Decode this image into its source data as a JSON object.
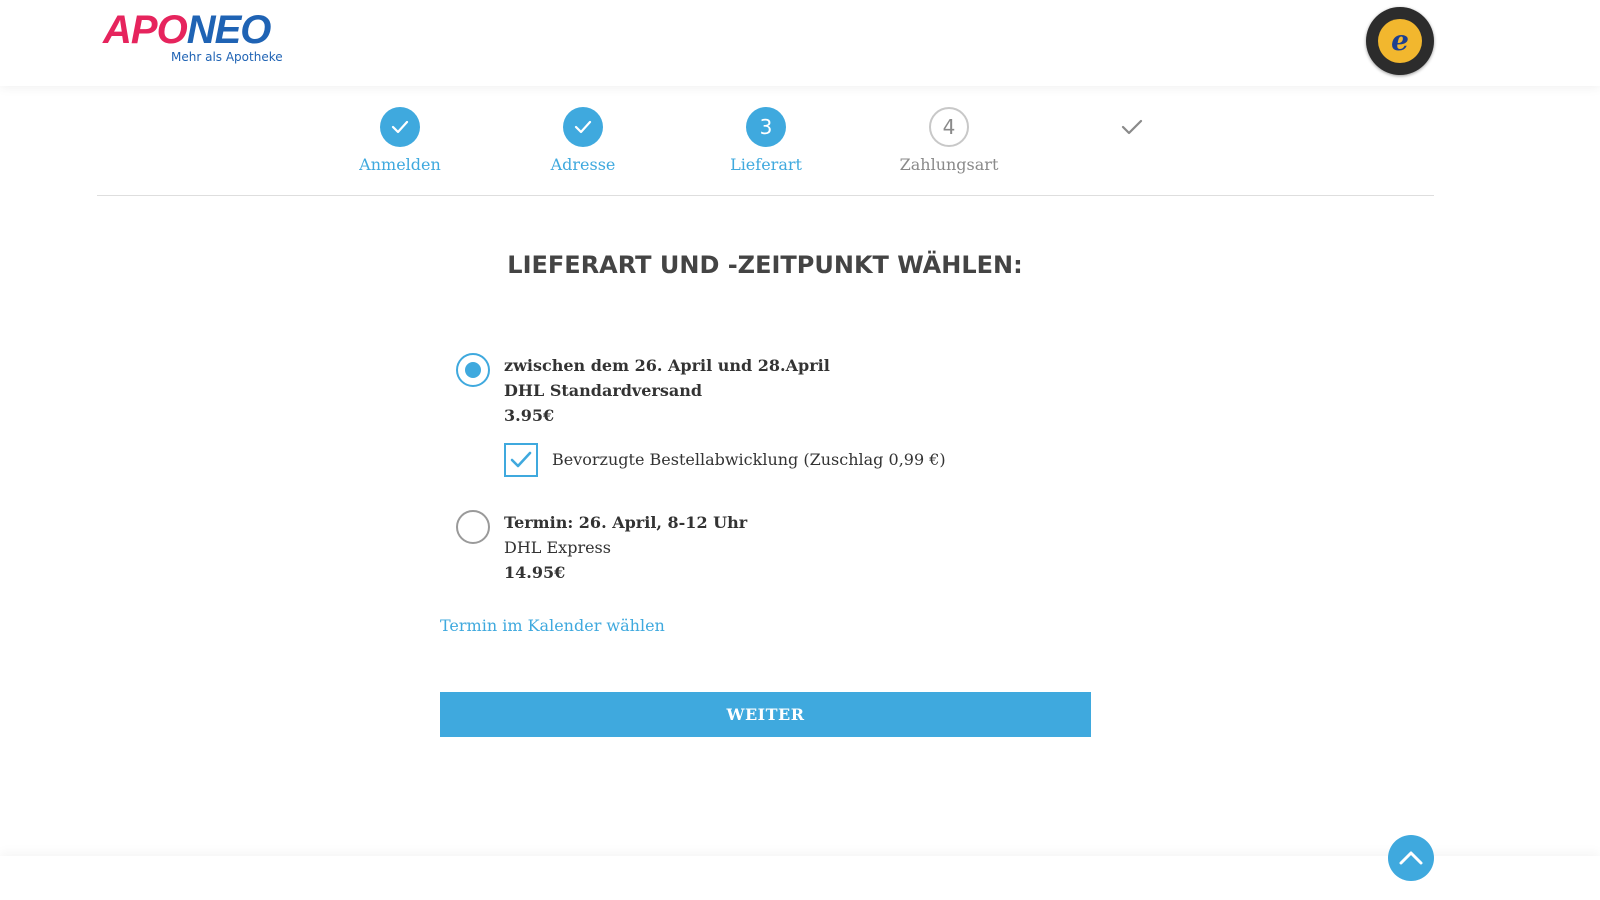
{
  "header": {
    "logo_apo": "APO",
    "logo_neo": "NEO",
    "logo_subtitle": "Mehr als Apotheke",
    "trust_badge_icon": "trusted-shops-guarantee-seal"
  },
  "stepper": {
    "steps": [
      {
        "label": "Anmelden",
        "state": "done",
        "indicator": ""
      },
      {
        "label": "Adresse",
        "state": "done",
        "indicator": ""
      },
      {
        "label": "Lieferart",
        "state": "active",
        "indicator": "3"
      },
      {
        "label": "Zahlungsart",
        "state": "upcoming",
        "indicator": "4"
      },
      {
        "label": "",
        "state": "final",
        "indicator": ""
      }
    ]
  },
  "main": {
    "title": "LIEFERART UND -ZEITPUNKT WÄHLEN:",
    "options": [
      {
        "selected": true,
        "date": "zwischen dem 26. April und 28.April",
        "carrier": "DHL Standardversand",
        "price": "3.95€"
      },
      {
        "selected": false,
        "date": "Termin: 26. April, 8-12 Uhr",
        "carrier": "DHL Express",
        "price": "14.95€"
      }
    ],
    "priority_checkbox": {
      "checked": true,
      "label": "Bevorzugte Bestellabwicklung (Zuschlag 0,99 €)"
    },
    "calendar_link": "Termin im Kalender wählen",
    "submit_label": "WEITER"
  },
  "colors": {
    "accent": "#3fa9de",
    "logo_pink": "#e6245d",
    "logo_blue": "#1f63b4",
    "muted": "#8a8a8a"
  }
}
